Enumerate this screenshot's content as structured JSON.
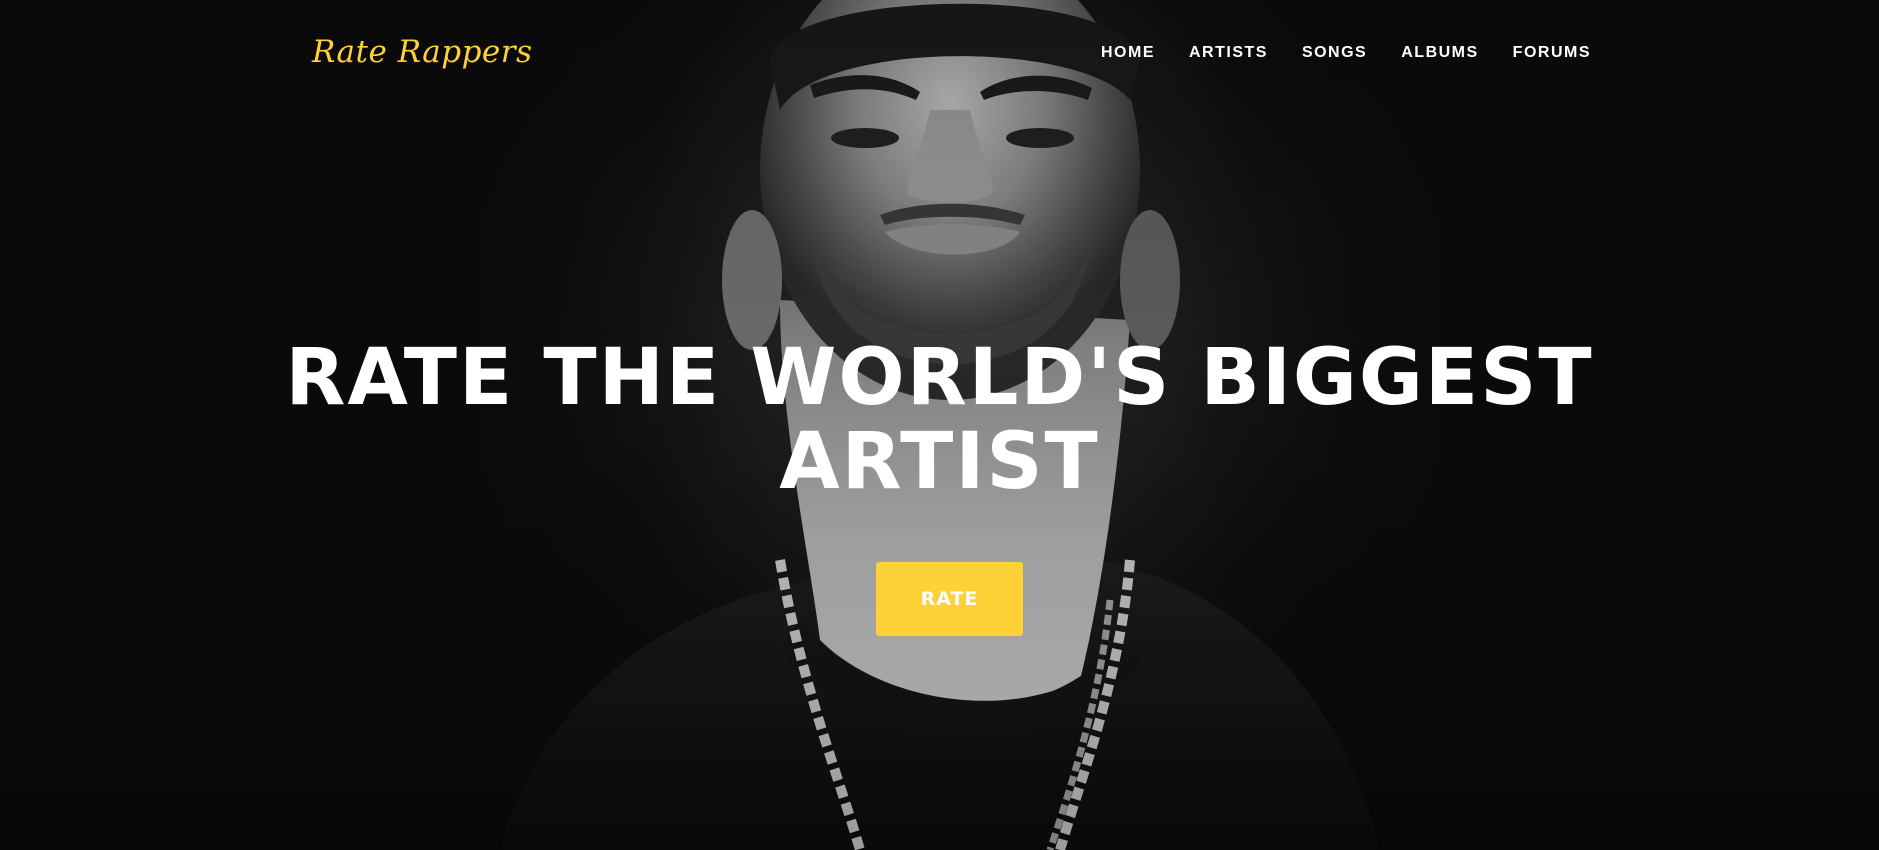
{
  "brand": {
    "name": "Rate Rappers",
    "color": "#fed136"
  },
  "nav": {
    "items": [
      {
        "label": "HOME"
      },
      {
        "label": "ARTISTS"
      },
      {
        "label": "SONGS"
      },
      {
        "label": "ALBUMS"
      },
      {
        "label": "FORUMS"
      }
    ]
  },
  "hero": {
    "heading_line1": "RATE THE WORLD'S BIGGEST",
    "heading_line2": "ARTIST",
    "button_label": "RATE",
    "button_color": "#fed136",
    "background_color": "#0b0b0b"
  }
}
